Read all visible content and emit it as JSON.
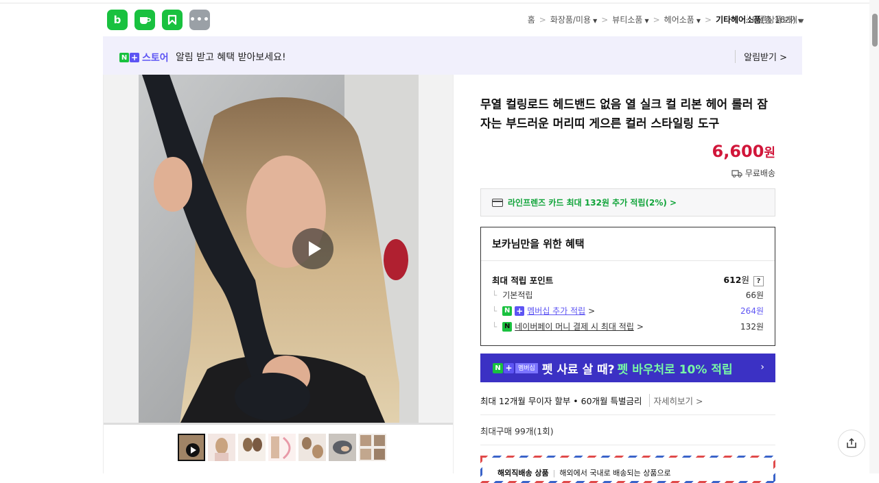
{
  "apps": [
    {
      "label": "b",
      "icon": "blog-icon"
    },
    {
      "label": "",
      "icon": "cafe-icon"
    },
    {
      "label": "",
      "icon": "store-k-icon"
    },
    {
      "label": "•••",
      "icon": "more-icon"
    }
  ],
  "breadcrumb": {
    "home": "홈",
    "sep": ">",
    "level1": "화장품/미용",
    "level2": "뷰티소품",
    "level3": "헤어소품",
    "level4": "기타헤어소품",
    "count": "(총 16개)",
    "more": "다른상품보기"
  },
  "banner": {
    "n": "N",
    "plus": "+",
    "store": "스토어",
    "message": "알림 받고 혜택 받아보세요!",
    "alarm": "알림받기 >"
  },
  "product": {
    "title": "무열 컬링로드 헤드밴드 없음 열 실크 컬 리본 헤어 롤러 잠자는 부드러운 머리띠 게으른 컬러 스타일링 도구",
    "price": "6,600",
    "currency": "원",
    "shipping": "무료배송"
  },
  "card_offer": "라인프렌즈 카드 최대 132원 추가 적립(2%) >",
  "benefit": {
    "header": "보카님만을 위한 혜택",
    "max_label": "최대 적립 포인트",
    "max_value": "612",
    "max_unit": "원",
    "help": "?",
    "tree": "└",
    "basic_label": "기본적립",
    "basic_value": "66원",
    "member_label": "멤버십 추가 적립",
    "member_value": "264원",
    "npay_label": "네이버페이 머니 결제 시 최대 적립",
    "npay_value": "132원",
    "chevron": ">"
  },
  "promo": {
    "membership": "멤버십",
    "text": "펫 사료 살 때?",
    "highlight": "펫 바우처로 10% 적립",
    "arrow": "›"
  },
  "installment": {
    "text": "최대 12개월 무이자 할부 • 60개월 특별금리",
    "more": "자세히보기 >"
  },
  "max_buy": "최대구매 99개(1회)",
  "overseas": {
    "title": "해외직배송 상품",
    "desc": "해외에서 국내로 배송되는 상품으로"
  },
  "thumbnail_count": 7,
  "colors": {
    "naver_green": "#19c13f",
    "store_purple": "#5d54f3",
    "price_red": "#d1163a",
    "promo_bg": "#3b31c4"
  }
}
